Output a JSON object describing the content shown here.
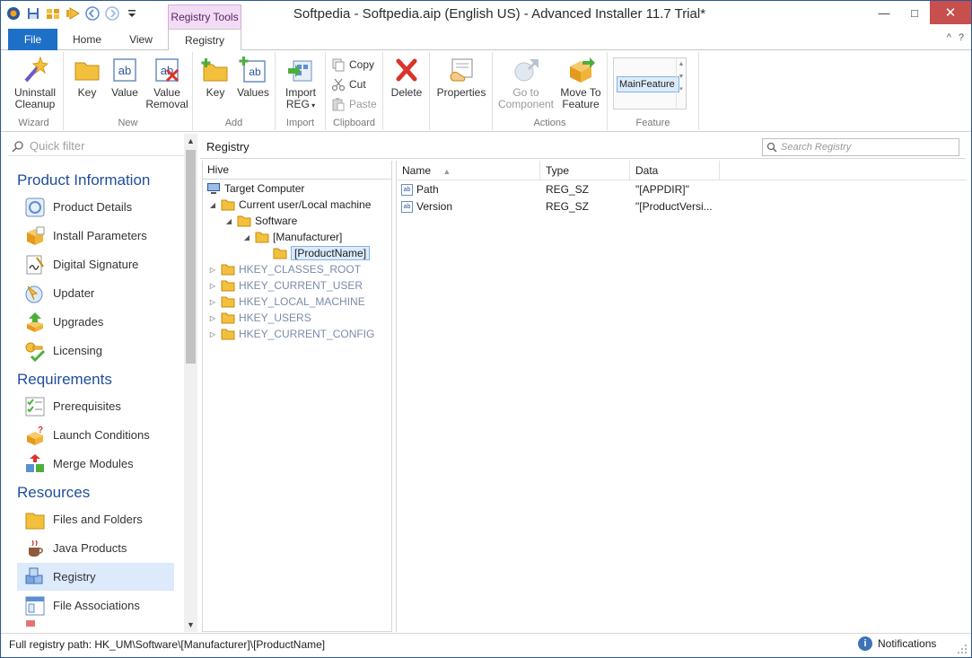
{
  "window": {
    "title": "Softpedia - Softpedia.aip (English US) - Advanced Installer 11.7 Trial*",
    "context_tab_group": "Registry Tools",
    "controls": {
      "minimize": "—",
      "maximize": "□",
      "close": "✕"
    }
  },
  "qat": {
    "icons": [
      "app-logo-icon",
      "save-icon",
      "build-icon",
      "run-icon",
      "back-icon",
      "forward-icon",
      "qat-dropdown-icon"
    ]
  },
  "tabs": {
    "file": "File",
    "home": "Home",
    "view": "View",
    "registry": "Registry",
    "collapse": "^",
    "help": "?"
  },
  "ribbon": {
    "wizard": {
      "label": "Wizard",
      "uninstall_line1": "Uninstall",
      "uninstall_line2": "Cleanup"
    },
    "new": {
      "label": "New",
      "key": "Key",
      "value": "Value",
      "value_removal_line1": "Value",
      "value_removal_line2": "Removal"
    },
    "add": {
      "label": "Add",
      "key": "Key",
      "values": "Values"
    },
    "import": {
      "label": "Import",
      "import_reg_line1": "Import",
      "import_reg_line2": "REG"
    },
    "clipboard": {
      "label": "Clipboard",
      "copy": "Copy",
      "cut": "Cut",
      "paste": "Paste"
    },
    "delete": {
      "label": "Delete"
    },
    "properties": {
      "label": "Properties"
    },
    "actions": {
      "label": "Actions",
      "go_to_line1": "Go to",
      "go_to_line2": "Component",
      "move_to_line1": "Move To",
      "move_to_line2": "Feature"
    },
    "feature": {
      "label": "Feature",
      "selected": "MainFeature"
    }
  },
  "leftnav": {
    "quick_filter_placeholder": "Quick filter",
    "sections": {
      "product_information": "Product Information",
      "requirements": "Requirements",
      "resources": "Resources"
    },
    "items": {
      "product_details": "Product Details",
      "install_parameters": "Install Parameters",
      "digital_signature": "Digital Signature",
      "updater": "Updater",
      "upgrades": "Upgrades",
      "licensing": "Licensing",
      "prerequisites": "Prerequisites",
      "launch_conditions": "Launch Conditions",
      "merge_modules": "Merge Modules",
      "files_and_folders": "Files and Folders",
      "java_products": "Java Products",
      "registry": "Registry",
      "file_associations": "File Associations"
    }
  },
  "main": {
    "title": "Registry",
    "search_placeholder": "Search Registry",
    "hive_header": "Hive",
    "tree": {
      "target_computer": "Target Computer",
      "current_user": "Current user/Local machine",
      "software": "Software",
      "manufacturer": "[Manufacturer]",
      "product_name": "[ProductName]",
      "hkcr": "HKEY_CLASSES_ROOT",
      "hkcu": "HKEY_CURRENT_USER",
      "hklm": "HKEY_LOCAL_MACHINE",
      "hku": "HKEY_USERS",
      "hkcc": "HKEY_CURRENT_CONFIG"
    },
    "columns": {
      "name": "Name",
      "type": "Type",
      "data": "Data"
    },
    "rows": [
      {
        "name": "Path",
        "type": "REG_SZ",
        "data": "\"[APPDIR]\""
      },
      {
        "name": "Version",
        "type": "REG_SZ",
        "data": "\"[ProductVersi..."
      }
    ],
    "ab_glyph": "ab"
  },
  "status": {
    "path": "Full registry path: HK_UM\\Software\\[Manufacturer]\\[ProductName]",
    "notifications": "Notifications",
    "info_glyph": "i"
  }
}
